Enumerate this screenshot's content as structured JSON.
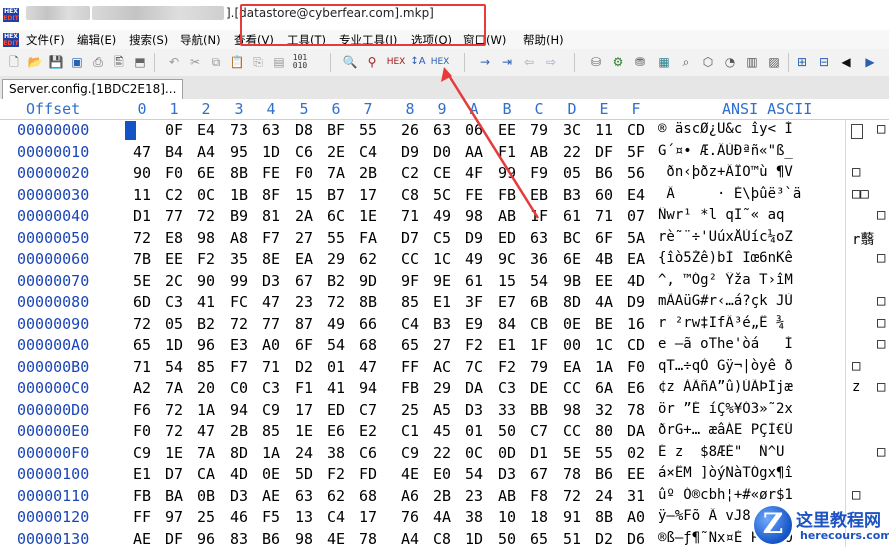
{
  "window": {
    "title_suffix": "].[datastore@cyberfear.com].mkp]"
  },
  "menu": [
    "文件(F)",
    "编辑(E)",
    "搜索(S)",
    "导航(N)",
    "查看(V)",
    "工具(T)",
    "专业工具(I)",
    "选项(O)",
    "窗口(W)",
    "帮助(H)"
  ],
  "tab": {
    "label": "Server.config.[1BDC2E18]..."
  },
  "header": {
    "offset_label": "Offset",
    "columns": [
      "0",
      "1",
      "2",
      "3",
      "4",
      "5",
      "6",
      "7",
      "8",
      "9",
      "A",
      "B",
      "C",
      "D",
      "E",
      "F"
    ],
    "ascii_label": "ANSI ASCII"
  },
  "rows": [
    {
      "offset": "00000000",
      "bytes": [
        "AE",
        "0F",
        "E4",
        "73",
        "63",
        "D8",
        "BF",
        "55",
        "26",
        "63",
        "06",
        "EE",
        "79",
        "3C",
        "11",
        "CD"
      ],
      "ascii": "® äscØ¿U&c îy< Í",
      "extra": "",
      "extra2": "□"
    },
    {
      "offset": "00000010",
      "bytes": [
        "47",
        "B4",
        "A4",
        "95",
        "1D",
        "C6",
        "2E",
        "C4",
        "D9",
        "D0",
        "AA",
        "F1",
        "AB",
        "22",
        "DF",
        "5F"
      ],
      "ascii": "G´¤• Æ.ÄÙÐªñ«\"ß_",
      "extra": "",
      "extra2": ""
    },
    {
      "offset": "00000020",
      "bytes": [
        "90",
        "F0",
        "6E",
        "8B",
        "FE",
        "F0",
        "7A",
        "2B",
        "C2",
        "CE",
        "4F",
        "99",
        "F9",
        "05",
        "B6",
        "56"
      ],
      "ascii": " ðn‹þðz+ÂÎO™ù ¶V",
      "extra": "□",
      "extra2": ""
    },
    {
      "offset": "00000030",
      "bytes": [
        "11",
        "C2",
        "0C",
        "1B",
        "8F",
        "15",
        "B7",
        "17",
        "C8",
        "5C",
        "FE",
        "FB",
        "EB",
        "B3",
        "60",
        "E4"
      ],
      "ascii": " Â     · È\\þûë³`ä",
      "extra": "□□",
      "extra2": ""
    },
    {
      "offset": "00000040",
      "bytes": [
        "D1",
        "77",
        "72",
        "B9",
        "81",
        "2A",
        "6C",
        "1E",
        "71",
        "49",
        "98",
        "AB",
        "1F",
        "61",
        "71",
        "07"
      ],
      "ascii": "Ñwr¹ *l qI˜« aq",
      "extra": "",
      "extra2": "□"
    },
    {
      "offset": "00000050",
      "bytes": [
        "72",
        "E8",
        "98",
        "A8",
        "F7",
        "27",
        "55",
        "FA",
        "D7",
        "C5",
        "D9",
        "ED",
        "63",
        "BC",
        "6F",
        "5A"
      ],
      "ascii": "rè˜¨÷'UúxÅÙíc¼oZ",
      "extra": "r蘙",
      "extra2": ""
    },
    {
      "offset": "00000060",
      "bytes": [
        "7B",
        "EE",
        "F2",
        "35",
        "8E",
        "EA",
        "29",
        "62",
        "CC",
        "1C",
        "49",
        "9C",
        "36",
        "6E",
        "4B",
        "EA"
      ],
      "ascii": "{îò5Žê)bÌ Iœ6nKê",
      "extra": "",
      "extra2": "□"
    },
    {
      "offset": "00000070",
      "bytes": [
        "5E",
        "2C",
        "90",
        "99",
        "D3",
        "67",
        "B2",
        "9D",
        "9F",
        "9E",
        "61",
        "15",
        "54",
        "9B",
        "EE",
        "4D"
      ],
      "ascii": "^, ™Óg² Ÿža T›îM",
      "extra": "",
      "extra2": ""
    },
    {
      "offset": "00000080",
      "bytes": [
        "6D",
        "C3",
        "41",
        "FC",
        "47",
        "23",
        "72",
        "8B",
        "85",
        "E1",
        "3F",
        "E7",
        "6B",
        "8D",
        "4A",
        "D9"
      ],
      "ascii": "mÃAüG#r‹…á?çk JÙ",
      "extra": "",
      "extra2": "□"
    },
    {
      "offset": "00000090",
      "bytes": [
        "72",
        "05",
        "B2",
        "72",
        "77",
        "87",
        "49",
        "66",
        "C4",
        "B3",
        "E9",
        "84",
        "CB",
        "0E",
        "BE",
        "16"
      ],
      "ascii": "r ²rw‡IfÄ³é„Ë ¾",
      "extra": "",
      "extra2": "□"
    },
    {
      "offset": "000000A0",
      "bytes": [
        "65",
        "1D",
        "96",
        "E3",
        "A0",
        "6F",
        "54",
        "68",
        "65",
        "27",
        "F2",
        "E1",
        "1F",
        "00",
        "1C",
        "CD"
      ],
      "ascii": "e –ã oThe'òá   Í",
      "extra": "",
      "extra2": "□"
    },
    {
      "offset": "000000B0",
      "bytes": [
        "71",
        "54",
        "85",
        "F7",
        "71",
        "D2",
        "01",
        "47",
        "FF",
        "AC",
        "7C",
        "F2",
        "79",
        "EA",
        "1A",
        "F0"
      ],
      "ascii": "qT…÷qÒ Gÿ¬|òyê ð",
      "extra": "□",
      "extra2": ""
    },
    {
      "offset": "000000C0",
      "bytes": [
        "A2",
        "7A",
        "20",
        "C0",
        "C3",
        "F1",
        "41",
        "94",
        "FB",
        "29",
        "DA",
        "C3",
        "DE",
        "CC",
        "6A",
        "E6"
      ],
      "ascii": "¢z ÀÃñA”û)ÚÃÞÌjæ",
      "extra": "z",
      "extra2": "□"
    },
    {
      "offset": "000000D0",
      "bytes": [
        "F6",
        "72",
        "1A",
        "94",
        "C9",
        "17",
        "ED",
        "C7",
        "25",
        "A5",
        "D3",
        "33",
        "BB",
        "98",
        "32",
        "78"
      ],
      "ascii": "ör ”É íÇ%¥Ó3»˜2x",
      "extra": "",
      "extra2": ""
    },
    {
      "offset": "000000E0",
      "bytes": [
        "F0",
        "72",
        "47",
        "2B",
        "85",
        "1E",
        "E6",
        "E2",
        "C1",
        "45",
        "01",
        "50",
        "C7",
        "CC",
        "80",
        "DA"
      ],
      "ascii": "ðrG+… æâÁE PÇÌ€Ú",
      "extra": "",
      "extra2": ""
    },
    {
      "offset": "000000F0",
      "bytes": [
        "C9",
        "1E",
        "7A",
        "8D",
        "1A",
        "24",
        "38",
        "C6",
        "C9",
        "22",
        "0C",
        "0D",
        "D1",
        "5E",
        "55",
        "02"
      ],
      "ascii": "É z  $8ÆÉ\"  Ñ^U",
      "extra": "",
      "extra2": "□"
    },
    {
      "offset": "00000100",
      "bytes": [
        "E1",
        "D7",
        "CA",
        "4D",
        "0E",
        "5D",
        "F2",
        "FD",
        "4E",
        "E0",
        "54",
        "D3",
        "67",
        "78",
        "B6",
        "EE"
      ],
      "ascii": "á×ÊM ]òýNàTÓgx¶î",
      "extra": "",
      "extra2": ""
    },
    {
      "offset": "00000110",
      "bytes": [
        "FB",
        "BA",
        "0B",
        "D3",
        "AE",
        "63",
        "62",
        "68",
        "A6",
        "2B",
        "23",
        "AB",
        "F8",
        "72",
        "24",
        "31"
      ],
      "ascii": "ûº Ó®cbh¦+#«ør$1",
      "extra": "□",
      "extra2": ""
    },
    {
      "offset": "00000120",
      "bytes": [
        "FF",
        "97",
        "25",
        "46",
        "F5",
        "13",
        "C4",
        "17",
        "76",
        "4A",
        "38",
        "10",
        "18",
        "91",
        "8B",
        "A0"
      ],
      "ascii": "ÿ—%Fõ Ä vJ8  ‘‹ ",
      "extra": "",
      "extra2": ""
    },
    {
      "offset": "00000130",
      "bytes": [
        "AE",
        "DF",
        "96",
        "83",
        "B6",
        "98",
        "4E",
        "78",
        "A4",
        "C8",
        "1D",
        "50",
        "65",
        "51",
        "D2",
        "D6"
      ],
      "ascii": "®ß–ƒ¶˜Nx¤È PeQÒÖ",
      "extra": "",
      "extra2": ""
    }
  ],
  "watermark": {
    "title": "这里教程网",
    "domain": "herecours.com"
  }
}
